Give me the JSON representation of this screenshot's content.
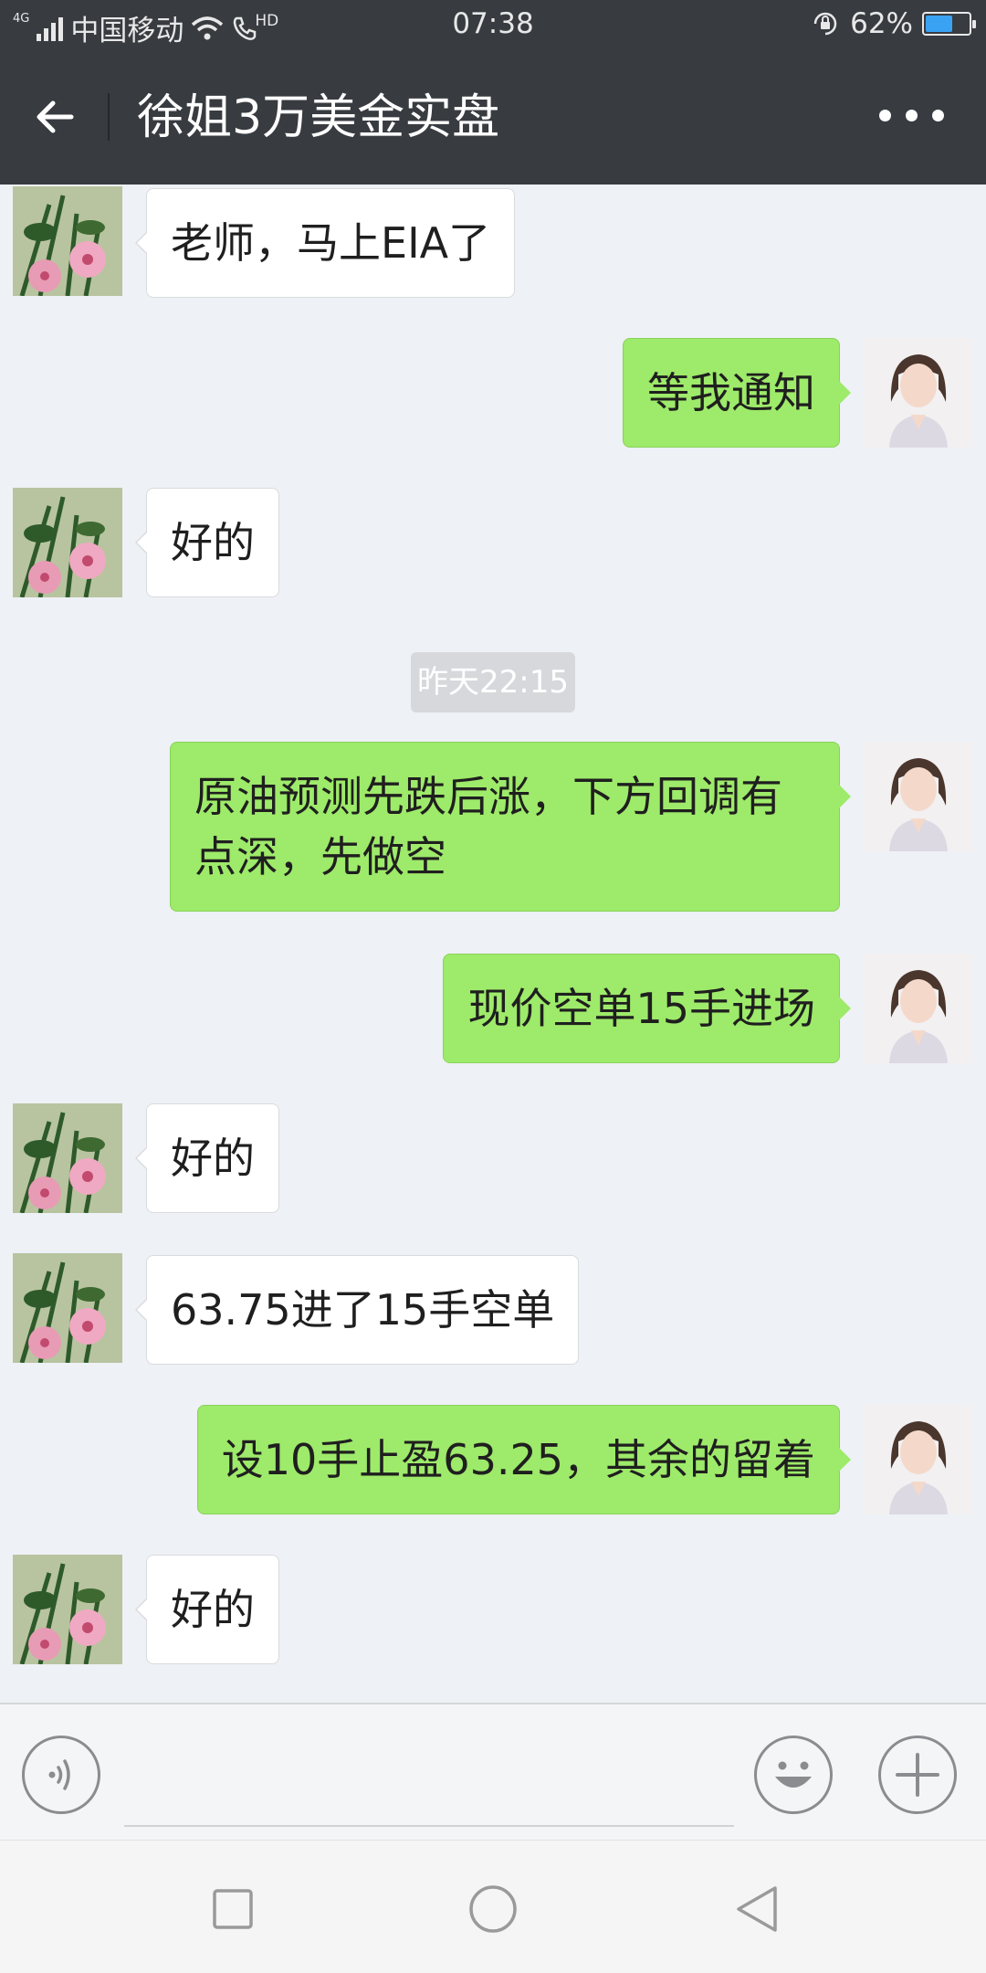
{
  "status_bar": {
    "network": "4G",
    "carrier": "中国移动",
    "hd": "HD",
    "time": "07:38",
    "battery": "62%",
    "battery_level": 0.62
  },
  "header": {
    "title": "徐姐3万美金实盘",
    "back_icon": "back-arrow-icon",
    "more_icon": "more-dots-icon"
  },
  "messages": [
    {
      "side": "in",
      "text": "老师，马上EIA了"
    },
    {
      "side": "out",
      "text": "等我通知"
    },
    {
      "side": "in",
      "text": "好的"
    },
    {
      "side": "out",
      "line1": "原油预测先跌后涨，下方回调有",
      "line2": "点深，先做空"
    },
    {
      "side": "out",
      "text": "现价空单15手进场"
    },
    {
      "side": "in",
      "text": "好的"
    },
    {
      "side": "in",
      "text": "63.75进了15手空单"
    },
    {
      "side": "out",
      "text": "设10手止盈63.25，其余的留着"
    },
    {
      "side": "in",
      "text": "好的"
    }
  ],
  "timestamp": "昨天22:15",
  "input_bar": {
    "voice_icon": "voice-icon",
    "emoji_icon": "emoji-icon",
    "plus_icon": "plus-icon"
  },
  "nav_bar": {
    "recent_icon": "square-icon",
    "home_icon": "circle-icon",
    "back_icon": "triangle-back-icon"
  }
}
